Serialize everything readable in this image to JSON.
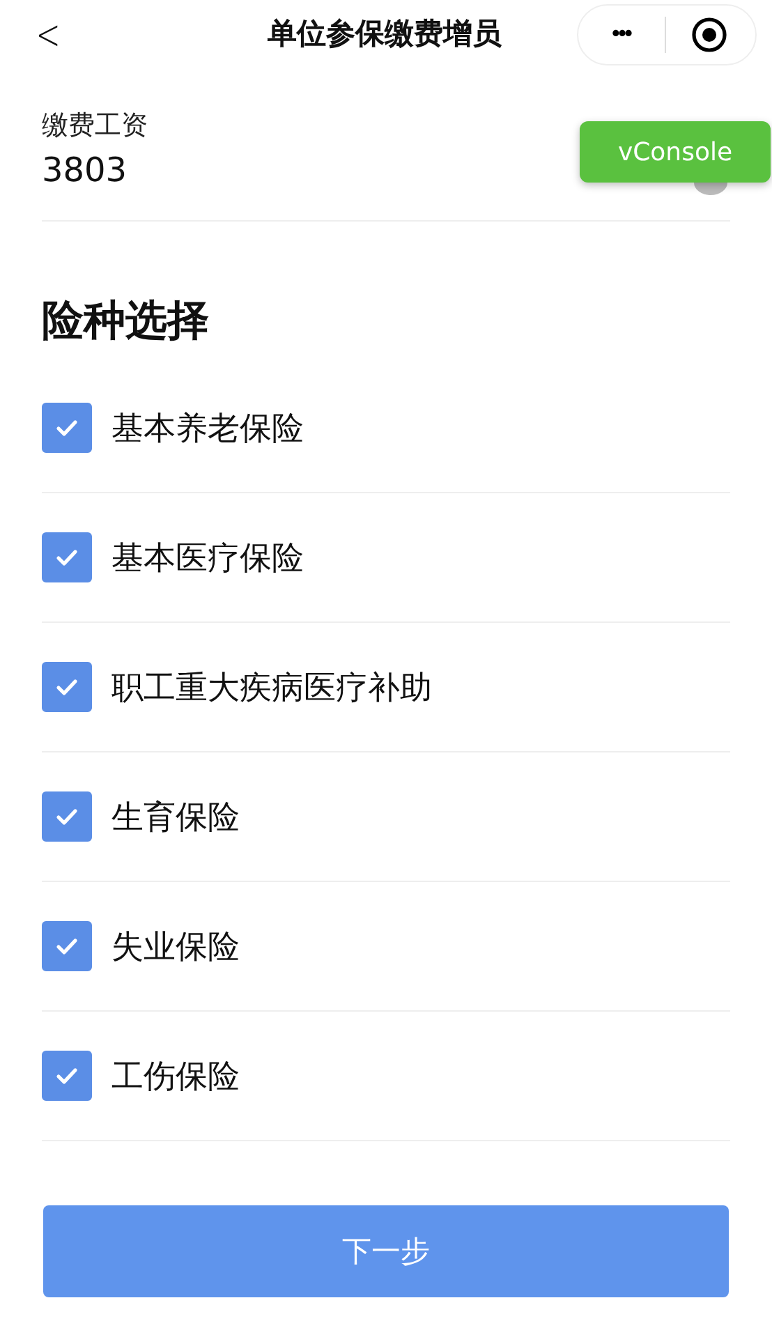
{
  "nav": {
    "back": "<",
    "title": "单位参保缴费增员",
    "more": "•••"
  },
  "field": {
    "label": "缴费工资",
    "value": "3803"
  },
  "section_title": "险种选择",
  "options": [
    {
      "label": "基本养老保险",
      "checked": true
    },
    {
      "label": "基本医疗保险",
      "checked": true
    },
    {
      "label": "职工重大疾病医疗补助",
      "checked": true
    },
    {
      "label": "生育保险",
      "checked": true
    },
    {
      "label": "失业保险",
      "checked": true
    },
    {
      "label": "工伤保险",
      "checked": true
    }
  ],
  "next_button": "下一步",
  "vconsole": "vConsole"
}
